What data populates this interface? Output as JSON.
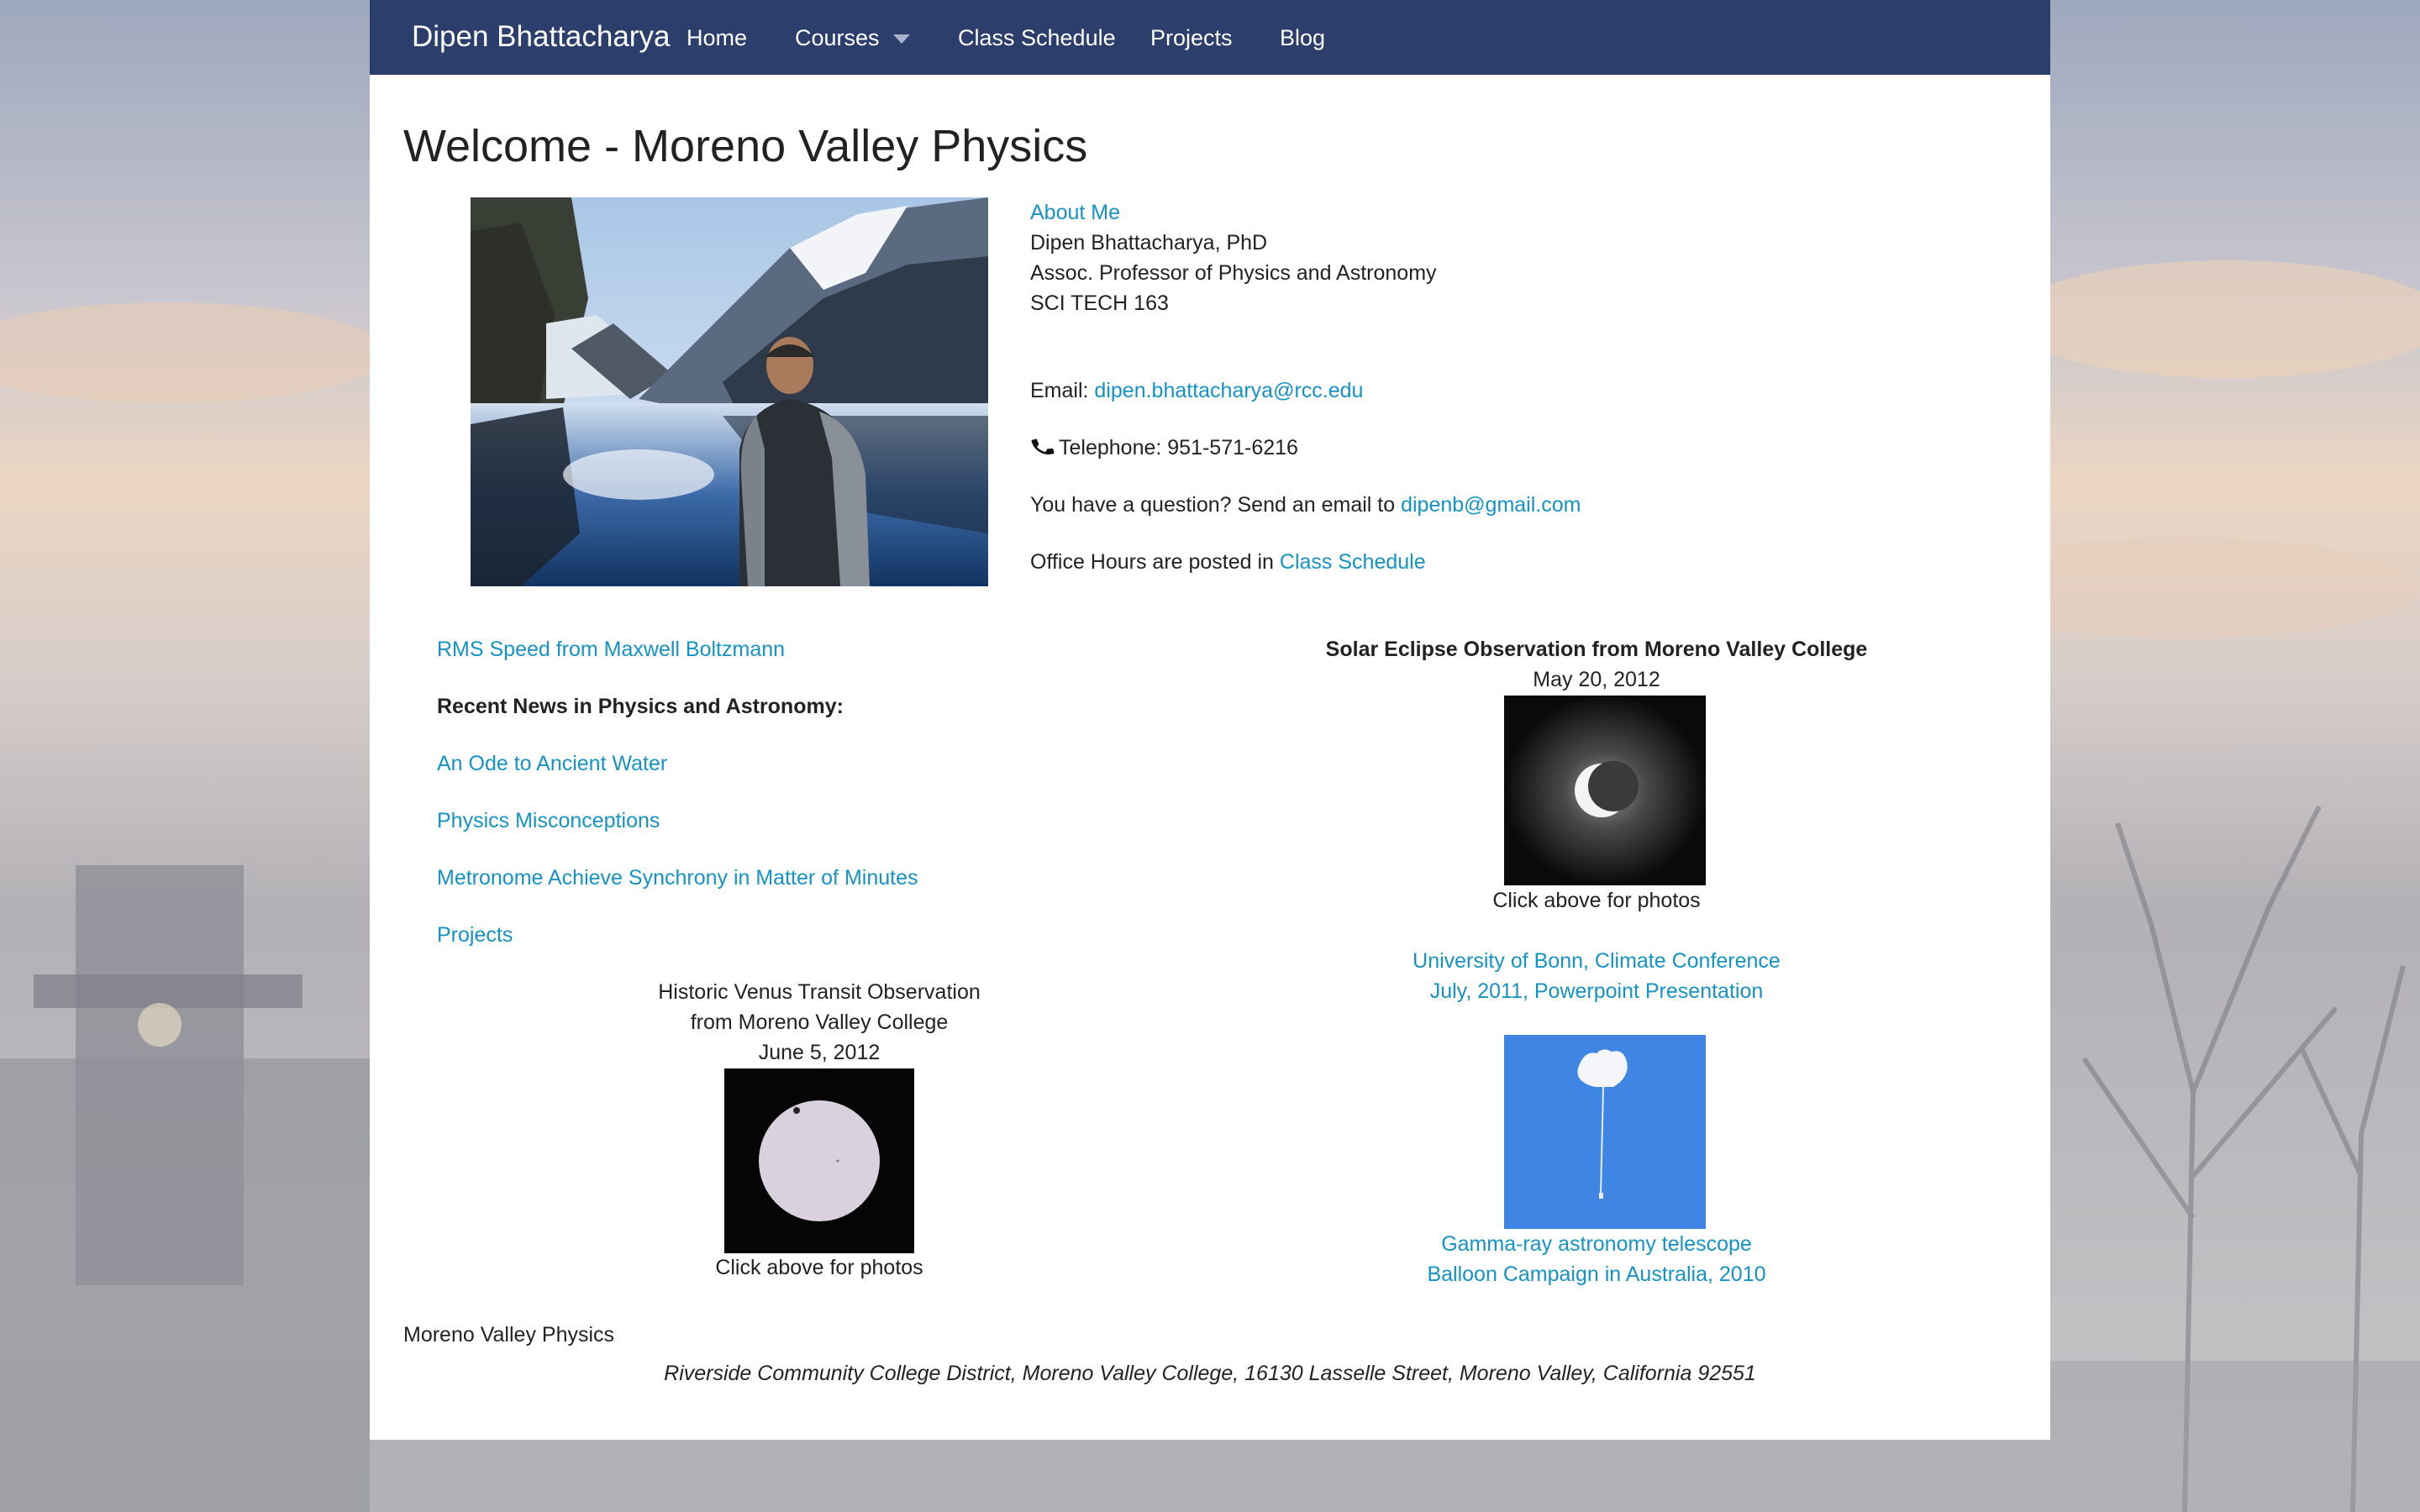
{
  "navbar": {
    "brand": "Dipen Bhattacharya",
    "items": [
      {
        "label": "Home"
      },
      {
        "label": "Courses"
      },
      {
        "label": "Class Schedule"
      },
      {
        "label": "Projects"
      },
      {
        "label": "Blog"
      }
    ]
  },
  "page": {
    "title": "Welcome - Moreno Valley Physics"
  },
  "about": {
    "link": "About Me",
    "name": "Dipen Bhattacharya, PhD",
    "position": "Assoc. Professor of Physics and Astronomy",
    "office": "SCI TECH 163",
    "email_label": "Email:",
    "email": "dipen.bhattacharya@rcc.edu",
    "phone_label": "Telephone: 951-571-6216",
    "question_text": "You have a question? Send an email to",
    "question_email": "dipenb@gmail.com",
    "office_hours_text": "Office Hours are posted in",
    "office_hours_link": "Class Schedule"
  },
  "left_column": {
    "rms_link": "RMS Speed from Maxwell Boltzmann",
    "news_heading": "Recent News in Physics and Astronomy:",
    "news_links": [
      "An Ode to Ancient Water",
      "Physics Misconceptions",
      "Metronome Achieve Synchrony in Matter of Minutes",
      "Projects"
    ],
    "venus_line1": "Historic Venus Transit Observation",
    "venus_line2": "from Moreno Valley College",
    "venus_date": "June 5, 2012",
    "venus_caption": "Click above for photos"
  },
  "right_column": {
    "eclipse_title": "Solar Eclipse Observation from Moreno Valley College",
    "eclipse_date": "May 20, 2012",
    "eclipse_caption": "Click above for photos",
    "bonn_line1": "University of Bonn, Climate Conference",
    "bonn_line2": "July, 2011, Powerpoint Presentation",
    "gamma_line1": "Gamma-ray astronomy telescope",
    "gamma_line2": "Balloon Campaign in Australia, 2010"
  },
  "footer": {
    "site_name": "Moreno Valley Physics",
    "address": "Riverside Community College District, Moreno Valley College, 16130 Lasselle Street, Moreno Valley, California 92551"
  },
  "colors": {
    "navbar": "#2c3e6b",
    "link": "#1593c4",
    "text": "#222222"
  }
}
